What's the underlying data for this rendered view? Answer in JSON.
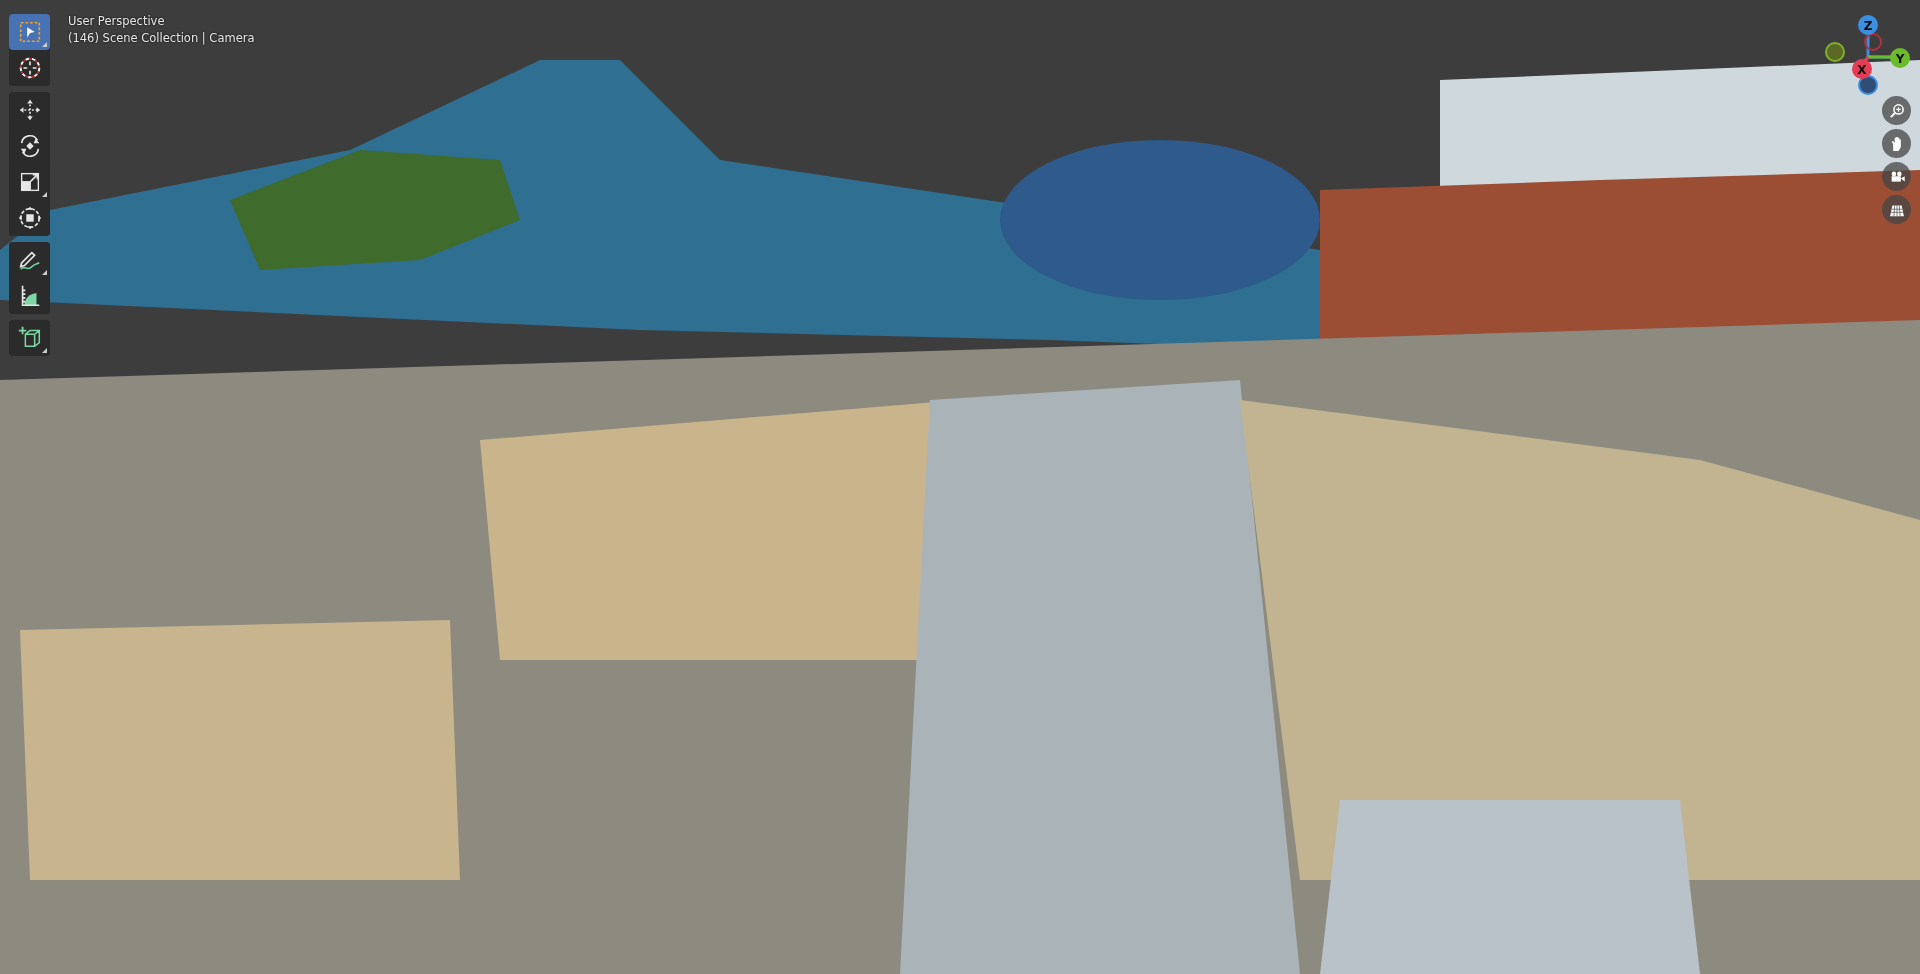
{
  "viewport": {
    "title": "User Perspective",
    "subtitle": "(146) Scene Collection | Camera"
  },
  "toolbar": [
    [
      {
        "kind": "select",
        "selected": true,
        "corner": true
      },
      {
        "kind": "cursor",
        "selected": false,
        "corner": false
      }
    ],
    [
      {
        "kind": "move",
        "selected": false,
        "corner": false
      },
      {
        "kind": "rotate",
        "selected": false,
        "corner": false
      },
      {
        "kind": "scale",
        "selected": false,
        "corner": true
      },
      {
        "kind": "transform",
        "selected": false,
        "corner": false
      }
    ],
    [
      {
        "kind": "annotate",
        "selected": false,
        "corner": true
      },
      {
        "kind": "measure",
        "selected": false,
        "corner": false
      }
    ],
    [
      {
        "kind": "add-cube",
        "selected": false,
        "corner": true
      }
    ]
  ],
  "gizmo": {
    "x": "X",
    "y": "Y",
    "z": "Z"
  },
  "nav_buttons": [
    {
      "kind": "zoom"
    },
    {
      "kind": "pan"
    },
    {
      "kind": "camera"
    },
    {
      "kind": "grid"
    }
  ]
}
